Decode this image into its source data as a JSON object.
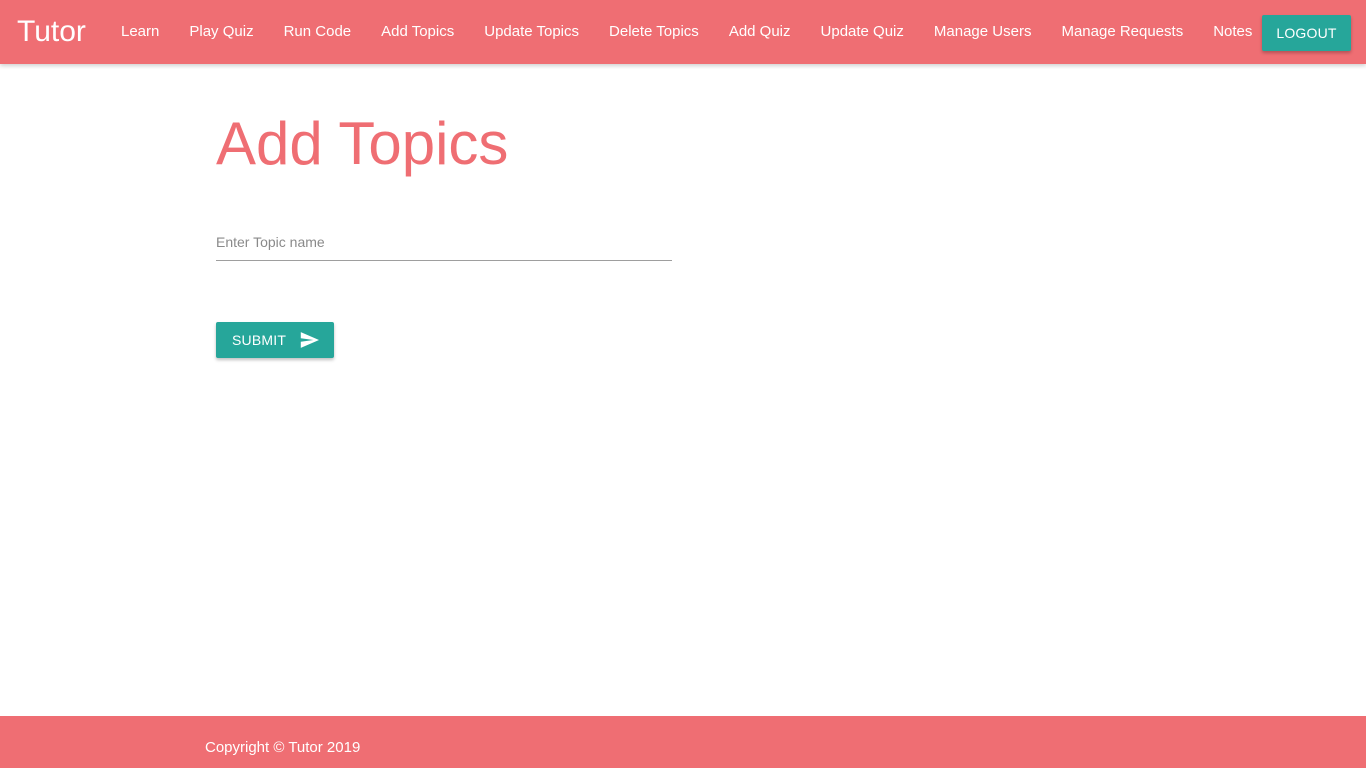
{
  "navbar": {
    "brand": "Tutor",
    "links": [
      {
        "label": "Learn"
      },
      {
        "label": "Play Quiz"
      },
      {
        "label": "Run Code"
      },
      {
        "label": "Add Topics"
      },
      {
        "label": "Update Topics"
      },
      {
        "label": "Delete Topics"
      },
      {
        "label": "Add Quiz"
      },
      {
        "label": "Update Quiz"
      },
      {
        "label": "Manage Users"
      },
      {
        "label": "Manage Requests"
      },
      {
        "label": "Notes"
      }
    ],
    "logout_label": "LOGOUT"
  },
  "main": {
    "title": "Add Topics",
    "topic_input": {
      "placeholder": "Enter Topic name",
      "value": ""
    },
    "submit_label": "SUBMIT",
    "submit_icon": "send-icon"
  },
  "footer": {
    "copyright": "Copyright © Tutor 2019"
  },
  "colors": {
    "primary": "#ef6e73",
    "accent": "#26a69a",
    "background": "#ffffff"
  }
}
